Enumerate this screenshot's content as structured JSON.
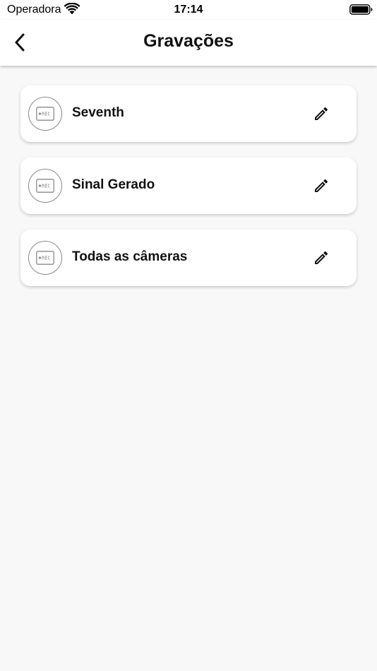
{
  "status_bar": {
    "carrier": "Operadora",
    "time": "17:14"
  },
  "header": {
    "title": "Gravações",
    "back_icon": "chevron-left-icon"
  },
  "recordings": [
    {
      "label": "Seventh",
      "icon": "rec-icon",
      "action_icon": "pencil-icon"
    },
    {
      "label": "Sinal Gerado",
      "icon": "rec-icon",
      "action_icon": "pencil-icon"
    },
    {
      "label": "Todas as câmeras",
      "icon": "rec-icon",
      "action_icon": "pencil-icon"
    }
  ],
  "rec_badge_text": "REC",
  "colors": {
    "background": "#f8f8f8",
    "card": "#ffffff",
    "text": "#111111",
    "icon_gray": "#8a8a8a"
  }
}
